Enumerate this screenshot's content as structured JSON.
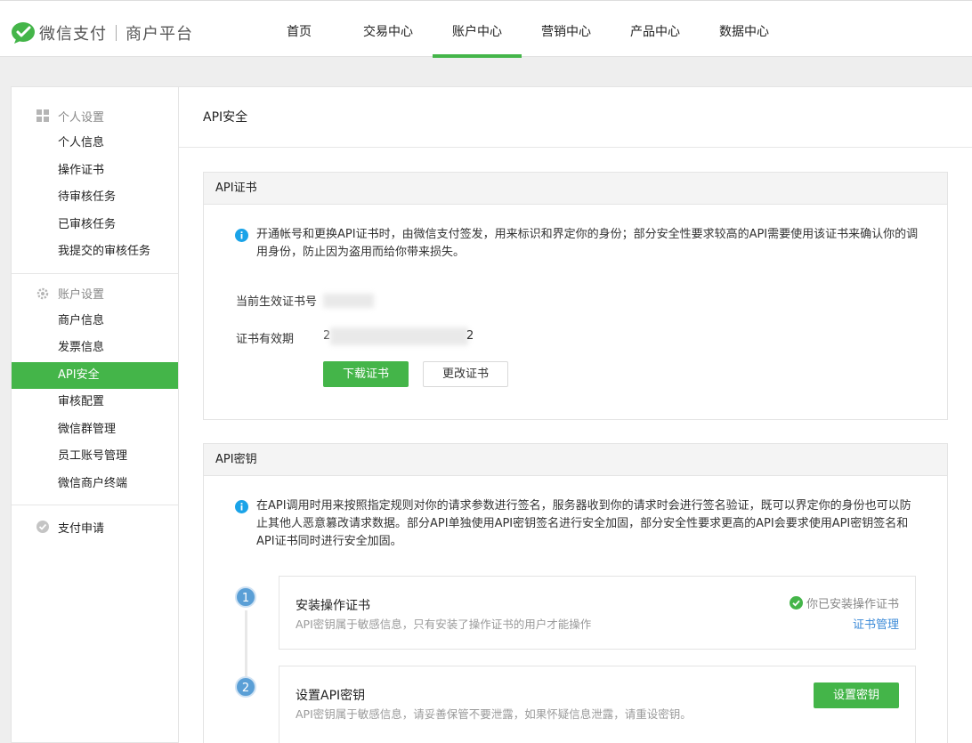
{
  "brand": {
    "name": "微信支付",
    "platform": "商户平台"
  },
  "nav": [
    {
      "label": "首页"
    },
    {
      "label": "交易中心"
    },
    {
      "label": "账户中心"
    },
    {
      "label": "营销中心"
    },
    {
      "label": "产品中心"
    },
    {
      "label": "数据中心"
    }
  ],
  "nav_active": "账户中心",
  "sidebar": {
    "personal_settings": {
      "title": "个人设置",
      "items": [
        "个人信息",
        "操作证书",
        "待审核任务",
        "已审核任务",
        "我提交的审核任务"
      ]
    },
    "account_settings": {
      "title": "账户设置",
      "items": [
        "商户信息",
        "发票信息",
        "API安全",
        "审核配置",
        "微信群管理",
        "员工账号管理",
        "微信商户终端"
      ]
    },
    "active_item": "API安全",
    "payment_apply": "支付申请"
  },
  "main": {
    "title": "API安全",
    "cert_section": {
      "header": "API证书",
      "info": "开通帐号和更换API证书时，由微信支付签发，用来标识和界定你的身份；部分安全性要求较高的API需要使用该证书来确认你的调用身份，防止因为盗用而给你带来损失。",
      "current_cert_label": "当前生效证书号",
      "validity_label": "证书有效期",
      "validity_prefix": "2",
      "validity_suffix": "2",
      "download_button": "下载证书",
      "change_button": "更改证书"
    },
    "key_section": {
      "header": "API密钥",
      "info": "在API调用时用来按照指定规则对你的请求参数进行签名，服务器收到你的请求时会进行签名验证，既可以界定你的身份也可以防止其他人恶意篡改请求数据。部分API单独使用API密钥签名进行安全加固，部分安全性要求更高的API会要求使用API密钥签名和API证书同时进行安全加固。",
      "steps": [
        {
          "number": "1",
          "title": "安装操作证书",
          "desc": "API密钥属于敏感信息，只有安装了操作证书的用户才能操作",
          "status": "你已安装操作证书",
          "link": "证书管理"
        },
        {
          "number": "2",
          "title": "设置API密钥",
          "desc": "API密钥属于敏感信息，请妥善保管不要泄露，如果怀疑信息泄露，请重设密钥。",
          "button": "设置密钥"
        }
      ]
    }
  },
  "colors": {
    "accent": "#44b549",
    "link": "#3d8bd8",
    "info_icon": "#1aa3e8",
    "step": "#5a9fd6"
  },
  "icons": {
    "logo": "wechat-pay-logo",
    "personal": "grid-icon",
    "account": "gear-icon",
    "apply": "pay-apply-icon",
    "info": "info-icon",
    "ok": "check-circle-icon"
  }
}
